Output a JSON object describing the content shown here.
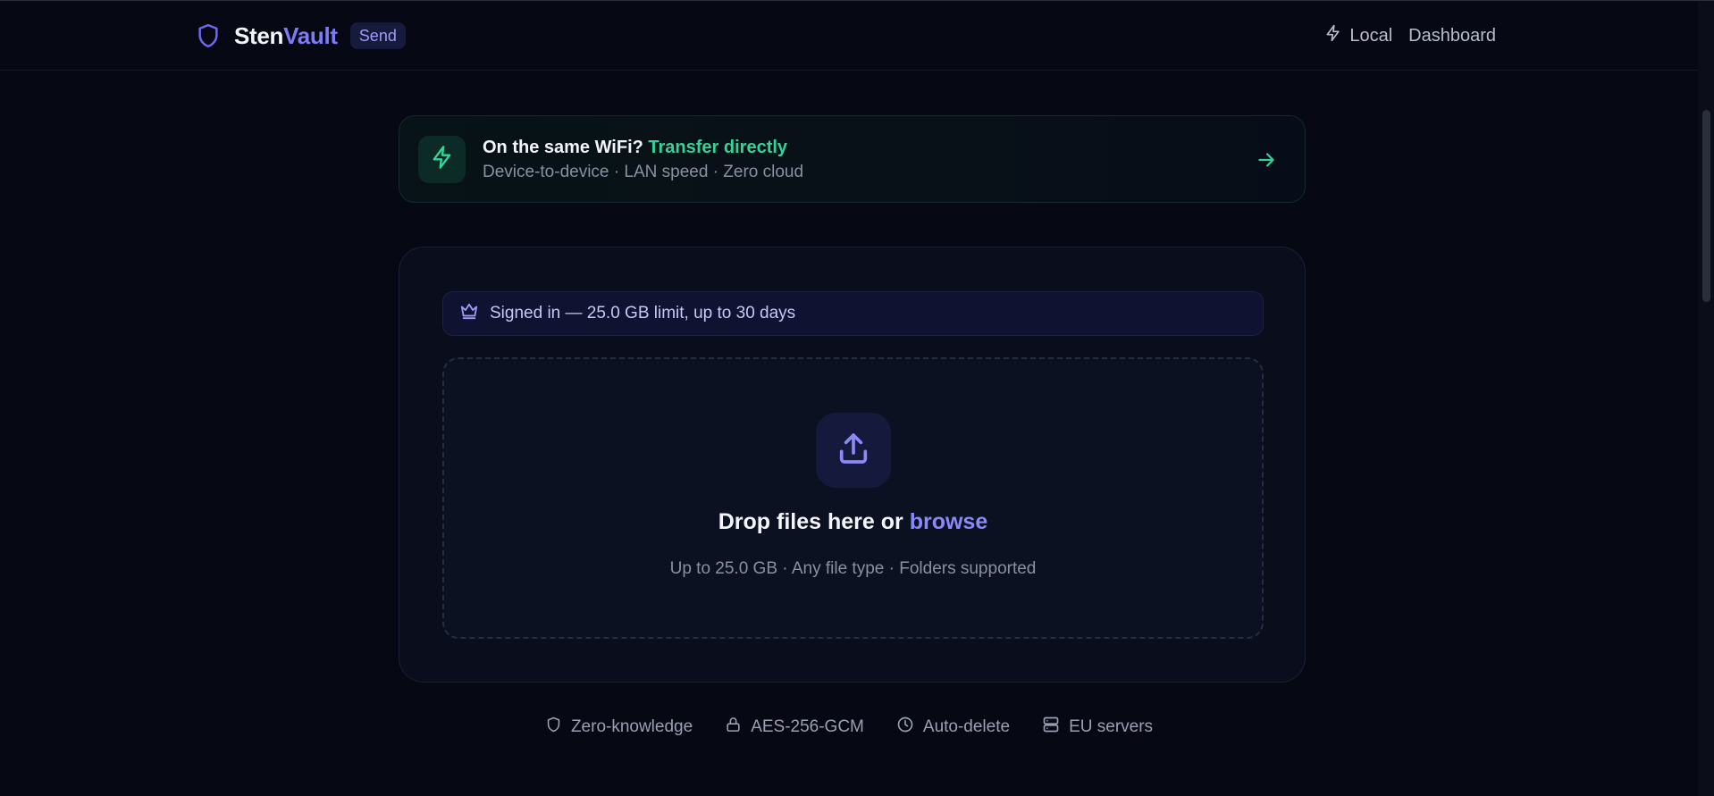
{
  "header": {
    "brand_part1": "Sten",
    "brand_part2": "Vault",
    "badge": "Send",
    "nav": {
      "local": "Local",
      "dashboard": "Dashboard"
    }
  },
  "wifi_banner": {
    "title": "On the same WiFi?",
    "highlight": "Transfer directly",
    "subtitle": "Device-to-device · LAN speed · Zero cloud"
  },
  "upload": {
    "signed_in_text": "Signed in — 25.0 GB limit, up to 30 days",
    "drop_text": "Drop files here or",
    "browse_text": "browse",
    "hint": "Up to 25.0 GB · Any file type · Folders supported"
  },
  "features": [
    {
      "label": "Zero-knowledge",
      "icon": "shield-icon"
    },
    {
      "label": "AES-256-GCM",
      "icon": "lock-icon"
    },
    {
      "label": "Auto-delete",
      "icon": "clock-icon"
    },
    {
      "label": "EU servers",
      "icon": "server-icon"
    }
  ],
  "colors": {
    "accent": "#7f7af6",
    "green": "#34d399",
    "background": "#060914"
  }
}
